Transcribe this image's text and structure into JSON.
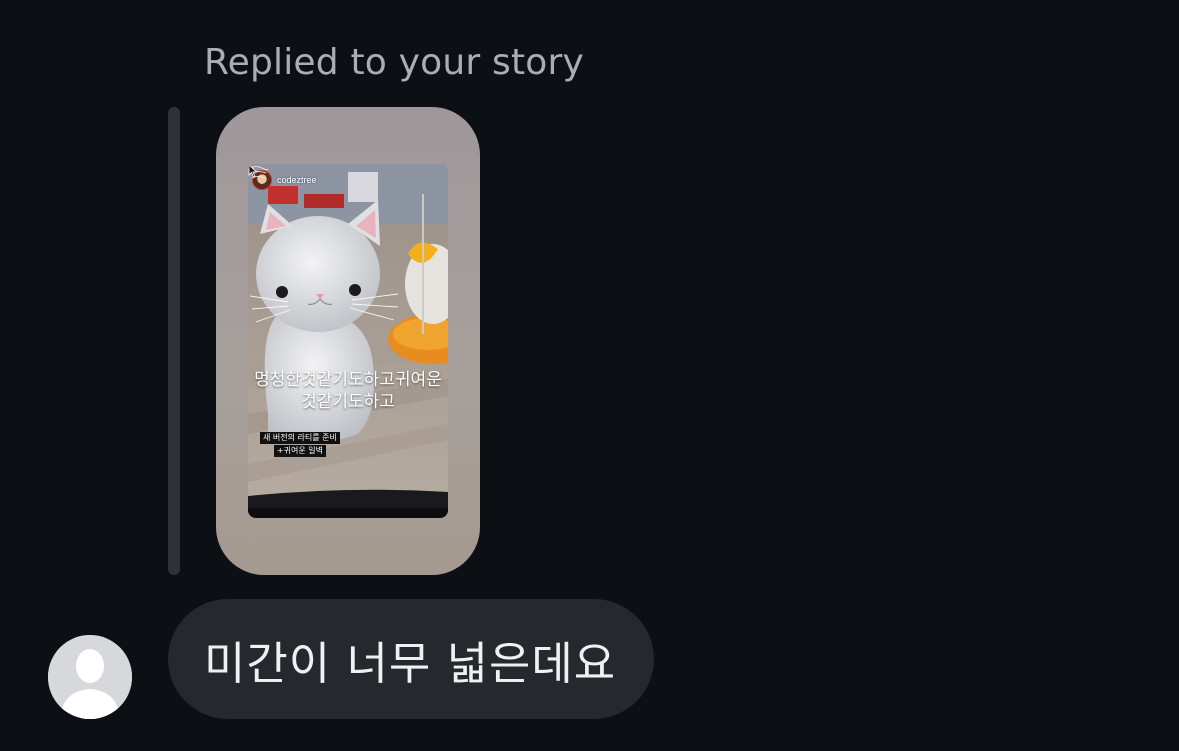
{
  "thread": {
    "reply_label": "Replied to your story"
  },
  "story": {
    "username": "codeztree",
    "caption_line1": "멍청한것같기도하고귀여운",
    "caption_line2": "것같기도하고",
    "tag_line1": "새 버전의 라티를 준비",
    "tag_line2": "+귀여운 일벽"
  },
  "message": {
    "text": "미간이 너무 넓은데요"
  },
  "colors": {
    "background": "#0c0f14",
    "bubble": "#25282d",
    "label": "#a9adb5",
    "message_text": "#eef0f3",
    "avatar_placeholder": "#d6d8dc"
  },
  "icons": {
    "avatar": "default-person-icon",
    "cursor": "mouse-cursor-icon"
  }
}
